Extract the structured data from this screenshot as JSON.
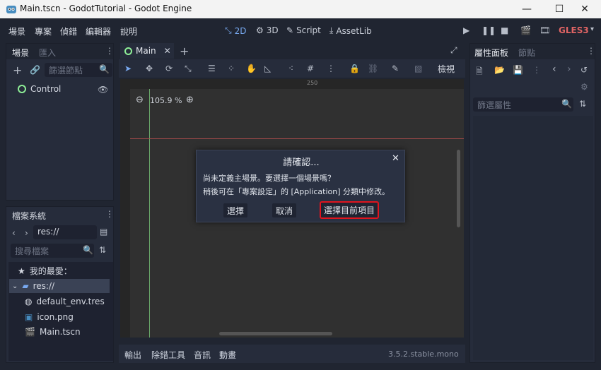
{
  "window": {
    "title": "Main.tscn - GodotTutorial - Godot Engine"
  },
  "menu": [
    "場景",
    "專案",
    "偵錯",
    "編輯器",
    "說明"
  ],
  "modes": {
    "two_d": "2D",
    "three_d": "3D",
    "script": "Script",
    "assetlib": "AssetLib"
  },
  "renderer": "GLES3",
  "scene_dock": {
    "tabs": [
      "場景",
      "匯入"
    ],
    "filter_placeholder": "篩選節點",
    "node": "Control"
  },
  "editor_tab": {
    "name": "Main"
  },
  "viewport": {
    "zoom": "105.9 %",
    "ruler_mark": "250"
  },
  "toolbar": {
    "view_label": "檢視"
  },
  "inspector": {
    "tabs": [
      "屬性面板",
      "節點"
    ],
    "filter_placeholder": "篩選屬性"
  },
  "filesystem": {
    "title": "檔案系統",
    "path": "res://",
    "search_placeholder": "搜尋檔案",
    "favorites": "我的最愛：",
    "root": "res://",
    "files": [
      "default_env.tres",
      "icon.png",
      "Main.tscn"
    ]
  },
  "bottom": {
    "tabs": [
      "輸出",
      "除錯工具",
      "音訊",
      "動畫"
    ],
    "version": "3.5.2.stable.mono"
  },
  "dialog": {
    "title": "請確認...",
    "line1": "尚未定義主場景。要選擇一個場景嗎？",
    "line2": "稍後可在「專案設定」的 [Application] 分類中修改。",
    "select": "選擇",
    "cancel": "取消",
    "select_current": "選擇目前項目"
  },
  "colors": {
    "accent": "#78a9f0",
    "highlight_border": "#e0141e",
    "node_green": "#8eef97"
  }
}
